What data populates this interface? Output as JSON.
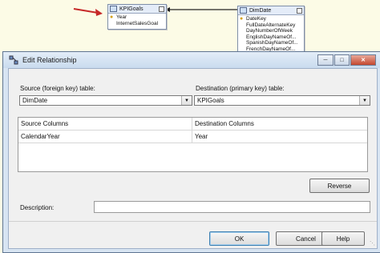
{
  "diagram": {
    "kpi_table": {
      "title": "KPIGoals",
      "key_column": "Year",
      "columns": [
        "InternetSalesGoal"
      ]
    },
    "date_table": {
      "title": "DimDate",
      "key_column": "DateKey",
      "columns": [
        "FullDateAlternateKey",
        "DayNumberOfWeek",
        "EnglishDayNameOf...",
        "SpanishDayNameOf...",
        "FrenchDayNameOf..."
      ]
    }
  },
  "dialog": {
    "title": "Edit Relationship",
    "source_label": "Source (foreign key) table:",
    "source_value": "DimDate",
    "dest_label": "Destination (primary key) table:",
    "dest_value": "KPIGoals",
    "grid": {
      "headers": [
        "Source Columns",
        "Destination Columns"
      ],
      "rows": [
        [
          "CalendarYear",
          "Year"
        ]
      ]
    },
    "reverse_label": "Reverse",
    "description_label": "Description:",
    "description_value": "",
    "ok_label": "OK",
    "cancel_label": "Cancel",
    "help_label": "Help"
  },
  "colors": {
    "arrow": "#c62828",
    "diagram_bg": "#fcfbe6",
    "dialog_frame": "#d7e4f2"
  }
}
